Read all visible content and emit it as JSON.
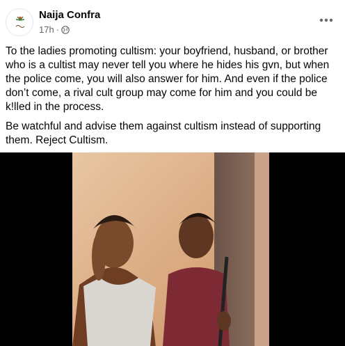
{
  "post": {
    "author": "Naija Confra",
    "time": "17h",
    "separator": "·",
    "privacy_icon": "globe-icon",
    "more_icon": "more-options-icon",
    "paragraphs": [
      "To the ladies promoting cultism: your boyfriend, husband, or brother who is a cultist may never tell you where he hides his gvn, but when the police come, you will also answer for him. And even if the police don’t come, a rival cult group may come for him and you could be k!lled in the process.",
      "Be watchful and advise them against cultism instead of supporting them. Reject Cultism."
    ]
  },
  "colors": {
    "text": "#050505",
    "secondary": "#65676b",
    "media_background": "#000000"
  }
}
